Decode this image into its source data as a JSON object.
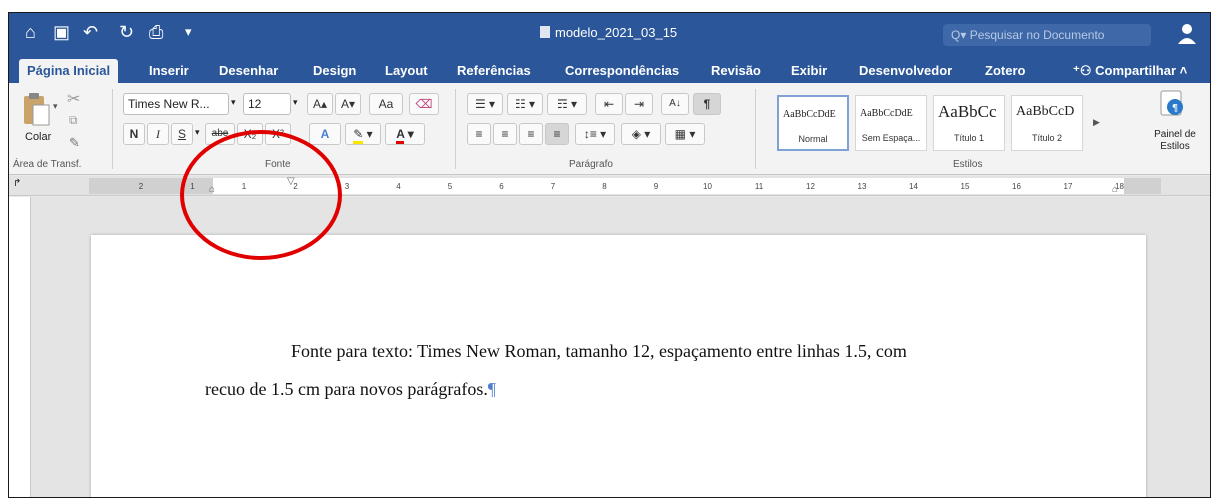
{
  "window": {
    "doc_title": "modelo_2021_03_15",
    "search_placeholder": "Pesquisar no Documento",
    "toolbar_glyphs": {
      "home": "⌂",
      "save": "▣",
      "undo": "↶",
      "redo": "↻",
      "print": "⎙",
      "more": "▾"
    }
  },
  "tabs": [
    {
      "label": "Página Inicial",
      "active": true
    },
    {
      "label": "Inserir"
    },
    {
      "label": "Desenhar"
    },
    {
      "label": "Design"
    },
    {
      "label": "Layout"
    },
    {
      "label": "Referências"
    },
    {
      "label": "Correspondências"
    },
    {
      "label": "Revisão"
    },
    {
      "label": "Exibir"
    },
    {
      "label": "Desenvolvedor"
    },
    {
      "label": "Zotero"
    }
  ],
  "share_label": "Compartilhar",
  "ribbon": {
    "clipboard": {
      "paste_label": "Colar",
      "group_label": "Área de Transf."
    },
    "font": {
      "font_name": "Times New R...",
      "font_size": "12",
      "group_label": "Fonte",
      "buttons": {
        "bold": "N",
        "italic": "I",
        "underline": "S",
        "strike": "abe",
        "sub": "X₂",
        "sup": "X²",
        "grow": "A▴",
        "shrink": "A▾",
        "case": "Aa",
        "effects": "A",
        "color": "A"
      }
    },
    "paragraph": {
      "group_label": "Parágrafo",
      "pilcrow": "¶"
    },
    "styles": {
      "group_label": "Estilos",
      "items": [
        {
          "sample": "AaBbCcDdE",
          "name": "Normal",
          "selected": true
        },
        {
          "sample": "AaBbCcDdE",
          "name": "Sem Espaça..."
        },
        {
          "sample": "AaBbCc",
          "name": "Título 1"
        },
        {
          "sample": "AaBbCcD",
          "name": "Título 2"
        }
      ]
    },
    "style_pane": {
      "label_line1": "Painel de",
      "label_line2": "Estilos"
    }
  },
  "ruler_ticks": [
    "2",
    "1",
    "1",
    "2",
    "3",
    "4",
    "5",
    "6",
    "7",
    "8",
    "9",
    "10",
    "11",
    "12",
    "13",
    "14",
    "15",
    "16",
    "17",
    "18"
  ],
  "document": {
    "line1": "Fonte para texto: Times New Roman, tamanho 12, espaçamento entre linhas 1.5, com",
    "line2": "recuo de 1.5 cm para novos parágrafos.",
    "end_mark": "¶"
  },
  "colors": {
    "title_bar": "#2b579a",
    "annotation": "#e00000"
  }
}
